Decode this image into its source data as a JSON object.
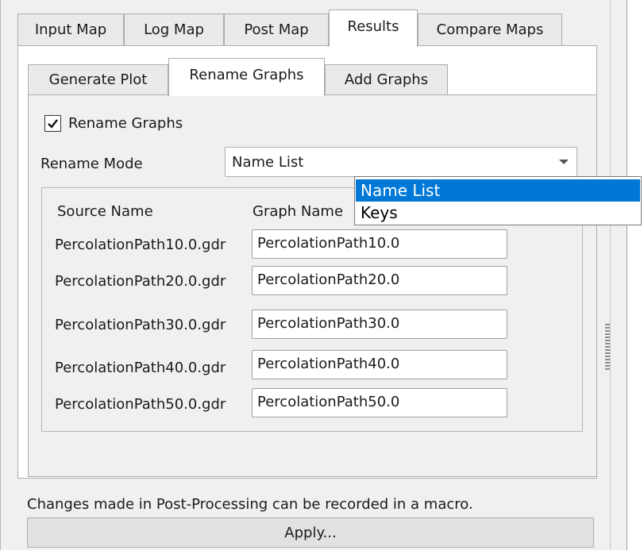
{
  "top_tabs": [
    {
      "label": "Input Map",
      "active": false
    },
    {
      "label": "Log Map",
      "active": false
    },
    {
      "label": "Post Map",
      "active": false
    },
    {
      "label": "Results",
      "active": true
    },
    {
      "label": "Compare Maps",
      "active": false
    }
  ],
  "sub_tabs": [
    {
      "label": "Generate Plot",
      "active": false
    },
    {
      "label": "Rename Graphs",
      "active": true
    },
    {
      "label": "Add Graphs",
      "active": false
    }
  ],
  "rename": {
    "checkbox_label": "Rename Graphs",
    "checked": true,
    "mode_label": "Rename Mode",
    "mode_value": "Name List",
    "options": [
      "Name List",
      "Keys"
    ]
  },
  "table": {
    "source_header": "Source Name",
    "graph_header": "Graph Name",
    "rows": [
      {
        "source": "PercolationPath10.0.gdr",
        "graph": "PercolationPath10.0"
      },
      {
        "source": "PercolationPath20.0.gdr",
        "graph": "PercolationPath20.0"
      },
      {
        "source": "PercolationPath30.0.gdr",
        "graph": "PercolationPath30.0"
      },
      {
        "source": "PercolationPath40.0.gdr",
        "graph": "PercolationPath40.0"
      },
      {
        "source": "PercolationPath50.0.gdr",
        "graph": "PercolationPath50.0"
      }
    ]
  },
  "footer": {
    "note": "Changes made in Post-Processing can be recorded in a macro.",
    "apply_label": "Apply..."
  }
}
